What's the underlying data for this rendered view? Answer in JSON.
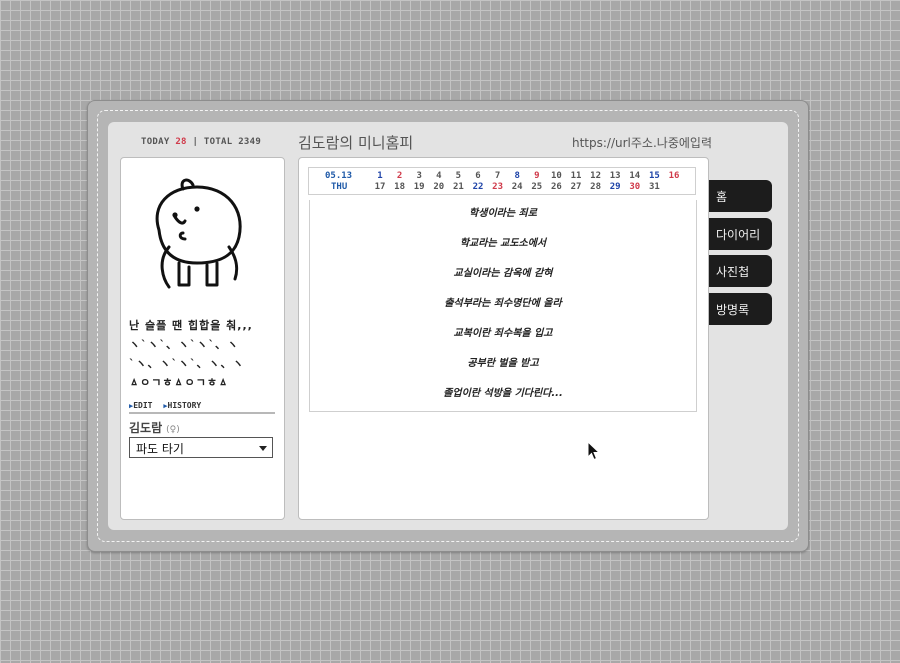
{
  "counter": {
    "today_label": "TODAY",
    "today_value": "28",
    "separator": "|",
    "total_label": "TOTAL",
    "total_value": "2349"
  },
  "header": {
    "title": "김도람의 미니홈피",
    "url": "https://url주소.나중에입력"
  },
  "profile": {
    "image_icon": "bear-icon",
    "status_lines": [
      "난 슬플 땐 힙합을 춰,,,",
      "ヽ`ヽ`、ヽ`ヽ`、ヽ",
      "`ヽ、ヽ`ヽ`、ヽ、ヽ",
      "ㅿㅇㄱㅎㅿㅇㄱㅎㅿ"
    ],
    "edit_label": "EDIT",
    "history_label": "HISTORY",
    "name": "김도람",
    "gender": "(♀)",
    "select_value": "파도 타기"
  },
  "calendar": {
    "date": "05.13",
    "weekday": "THU",
    "days_row1": [
      {
        "d": "1",
        "c": "blue"
      },
      {
        "d": "2",
        "c": "red"
      },
      {
        "d": "3",
        "c": ""
      },
      {
        "d": "4",
        "c": ""
      },
      {
        "d": "5",
        "c": ""
      },
      {
        "d": "6",
        "c": ""
      },
      {
        "d": "7",
        "c": ""
      },
      {
        "d": "8",
        "c": "blue"
      },
      {
        "d": "9",
        "c": "red"
      },
      {
        "d": "10",
        "c": ""
      },
      {
        "d": "11",
        "c": ""
      },
      {
        "d": "12",
        "c": ""
      },
      {
        "d": "13",
        "c": ""
      },
      {
        "d": "14",
        "c": ""
      },
      {
        "d": "15",
        "c": "blue"
      },
      {
        "d": "16",
        "c": "red"
      }
    ],
    "days_row2": [
      {
        "d": "17",
        "c": ""
      },
      {
        "d": "18",
        "c": ""
      },
      {
        "d": "19",
        "c": ""
      },
      {
        "d": "20",
        "c": ""
      },
      {
        "d": "21",
        "c": ""
      },
      {
        "d": "22",
        "c": "blue"
      },
      {
        "d": "23",
        "c": "red"
      },
      {
        "d": "24",
        "c": ""
      },
      {
        "d": "25",
        "c": ""
      },
      {
        "d": "26",
        "c": ""
      },
      {
        "d": "27",
        "c": ""
      },
      {
        "d": "28",
        "c": ""
      },
      {
        "d": "29",
        "c": "blue"
      },
      {
        "d": "30",
        "c": "red"
      },
      {
        "d": "31",
        "c": ""
      }
    ],
    "colors": {
      "blue": "#1f44a8",
      "red": "#d03a4a",
      "default": "#555555"
    }
  },
  "poem": [
    "학생이라는 죄로",
    "학교라는 교도소에서",
    "교실이라는 감옥에 갇혀",
    "출석부라는 죄수명단에 올라",
    "교복이란 죄수복을 입고",
    "공부란 벌을 받고",
    "졸업이란 석방을 기다린다..."
  ],
  "nav": [
    {
      "label": "홈"
    },
    {
      "label": "다이어리"
    },
    {
      "label": "사진첩"
    },
    {
      "label": "방명록"
    }
  ]
}
